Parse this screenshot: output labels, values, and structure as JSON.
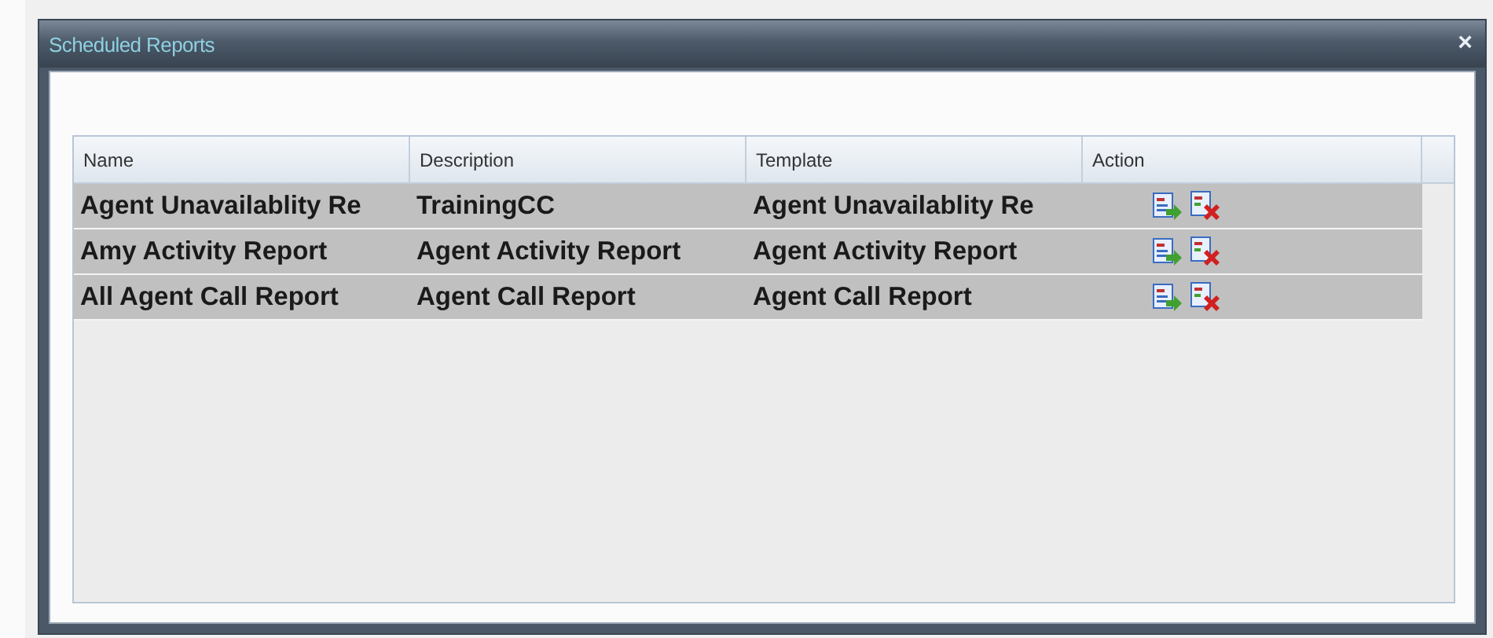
{
  "window": {
    "title": "Scheduled Reports",
    "close": "×"
  },
  "table": {
    "columns": [
      "Name",
      "Description",
      "Template",
      "Action"
    ],
    "rows": [
      {
        "name": "Agent Unavailablity Re",
        "description": "TrainingCC",
        "template": "Agent Unavailablity Re"
      },
      {
        "name": "Amy Activity Report",
        "description": "Agent Activity Report",
        "template": "Agent Activity Report"
      },
      {
        "name": "All Agent Call Report",
        "description": "Agent Call Report",
        "template": "Agent Call Report"
      }
    ]
  }
}
